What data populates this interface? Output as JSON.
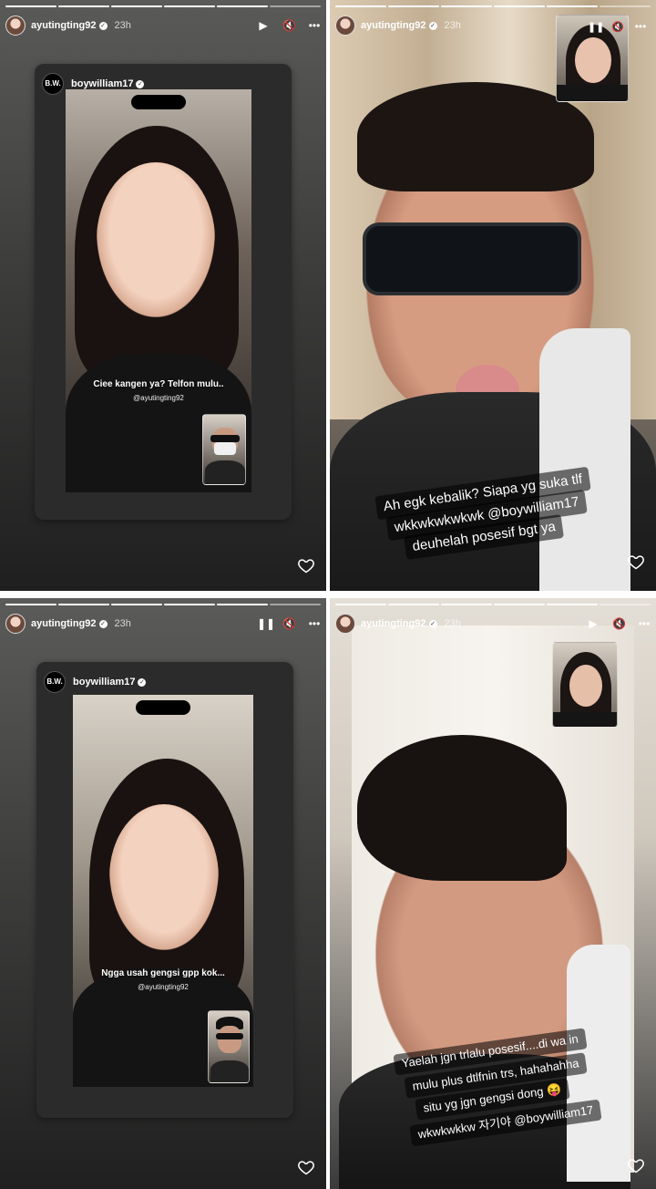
{
  "stories": [
    {
      "username": "ayutingting92",
      "time": "23h",
      "controls": [
        "▶",
        "🔇",
        "•••"
      ],
      "reshare": {
        "username": "boywilliam17",
        "logo": "B.W.",
        "caption": "Ciee kangen ya? Telfon mulu..",
        "mention": "@ayutingting92"
      }
    },
    {
      "username": "ayutingting92",
      "time": "23h",
      "controls": [
        "❚❚",
        "🔇",
        "•••"
      ],
      "stickers": [
        "Ah egk kebalik? Siapa yg suka tlf",
        "wkkwkwkwkwk @boywilliam17",
        "deuhelah posesif bgt ya"
      ]
    },
    {
      "username": "ayutingting92",
      "time": "23h",
      "controls": [
        "❚❚",
        "🔇",
        "•••"
      ],
      "reshare": {
        "username": "boywilliam17",
        "logo": "B.W.",
        "caption": "Ngga usah gengsi gpp kok...",
        "mention": "@ayutingting92"
      }
    },
    {
      "username": "ayutingting92",
      "time": "23h",
      "controls": [
        "▶",
        "🔇",
        "•••"
      ],
      "stickers": [
        "Yaelah jgn trlalu posesif....di wa in",
        "mulu plus dtlfnin trs, hahahahha",
        "situ yg jgn gengsi dong 😝",
        "wkwkwkkw 자기야 @boywilliam17"
      ]
    }
  ],
  "icons": {
    "heart": "heart-icon",
    "verified": "verified-badge-icon"
  }
}
